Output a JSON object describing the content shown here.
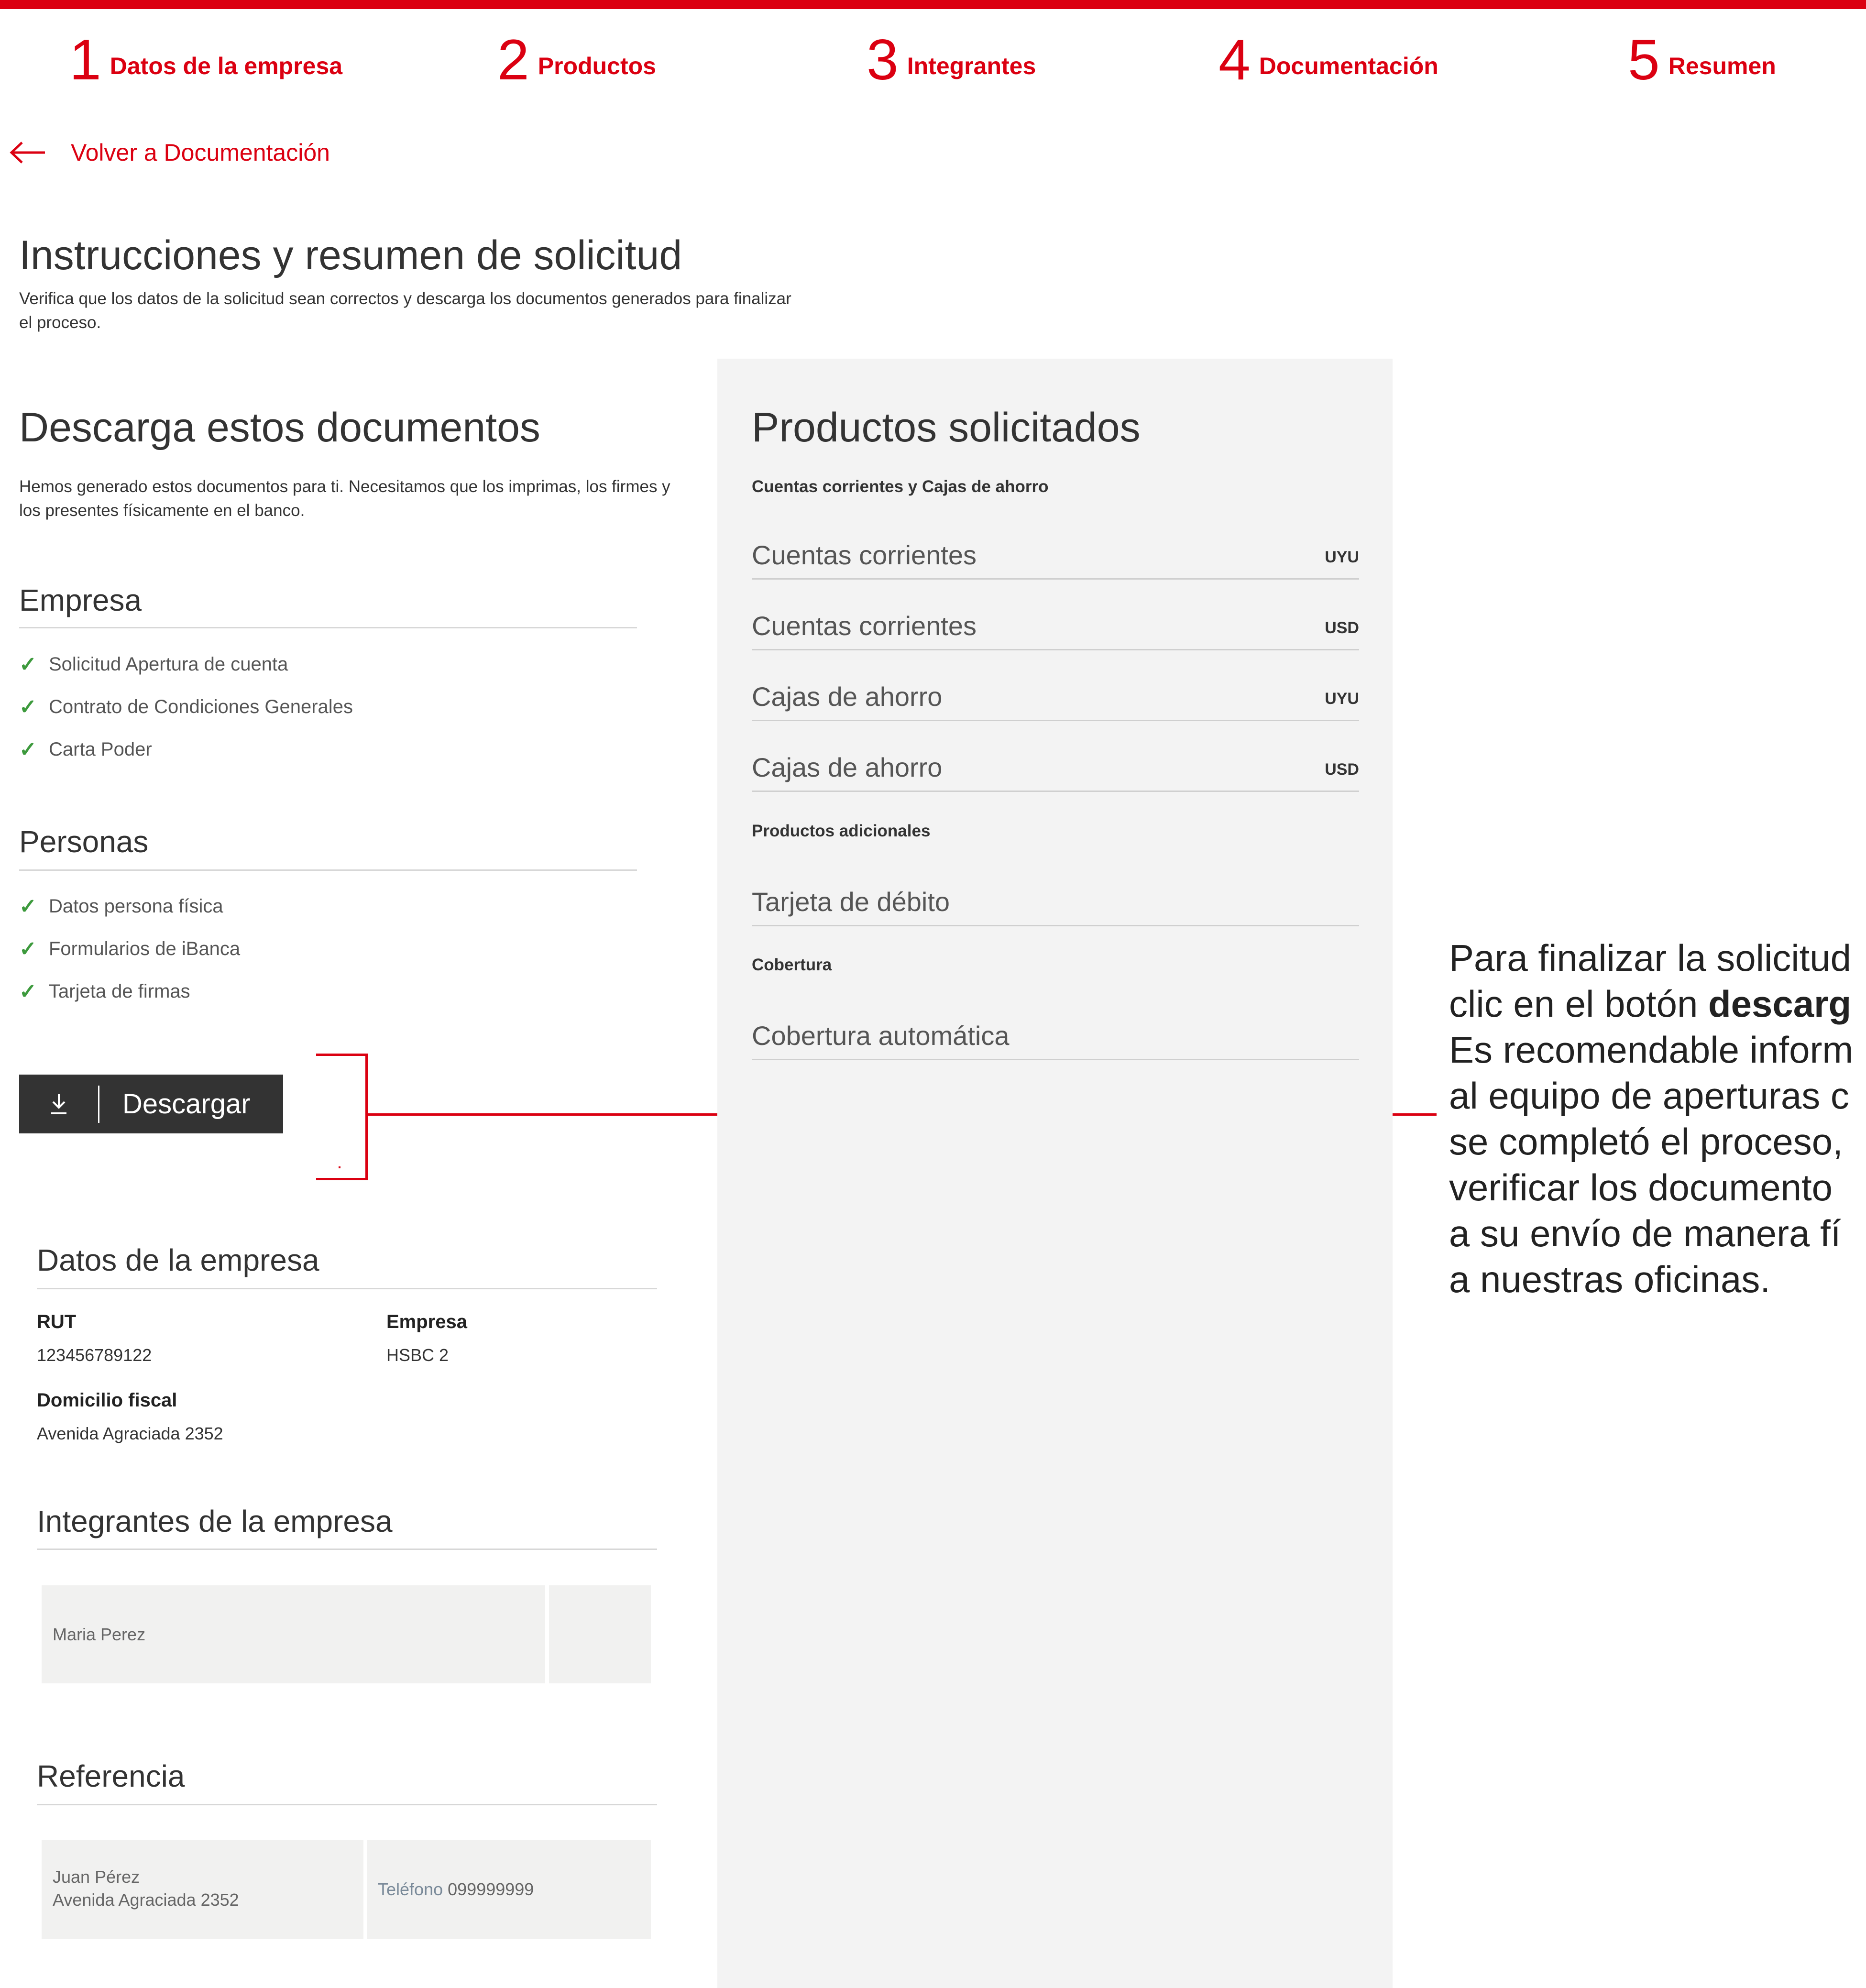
{
  "steps": [
    {
      "num": "1",
      "label": "Datos de la empresa"
    },
    {
      "num": "2",
      "label": "Productos"
    },
    {
      "num": "3",
      "label": "Integrantes"
    },
    {
      "num": "4",
      "label": "Documentación"
    },
    {
      "num": "5",
      "label": "Resumen"
    }
  ],
  "back_link": "Volver a Documentación",
  "page": {
    "title": "Instrucciones y resumen de solicitud",
    "subtitle": "Verifica que los datos de la solicitud sean correctos y descarga los documentos generados para finalizar el proceso."
  },
  "downloads": {
    "title": "Descarga estos documentos",
    "description": "Hemos generado estos documentos para ti. Necesitamos que los imprimas, los firmes y los presentes físicamente en el banco.",
    "empresa": {
      "heading": "Empresa",
      "items": [
        "Solicitud Apertura de cuenta",
        "Contrato de Condiciones Generales",
        "Carta Poder"
      ]
    },
    "personas": {
      "heading": "Personas",
      "items": [
        "Datos persona física",
        "Formularios de iBanca",
        "Tarjeta de firmas"
      ]
    },
    "button_label": "Descargar"
  },
  "company_data": {
    "heading": "Datos de la empresa",
    "rut_label": "RUT",
    "rut_value": "123456789122",
    "empresa_label": "Empresa",
    "empresa_value": "HSBC 2",
    "domicilio_label": "Domicilio fiscal",
    "domicilio_value": "Avenida Agraciada 2352"
  },
  "members": {
    "heading": "Integrantes de la empresa",
    "name": "Maria Perez"
  },
  "reference": {
    "heading": "Referencia",
    "name": "Juan Pérez",
    "address": "Avenida Agraciada 2352",
    "phone_label": "Teléfono",
    "phone_value": "099999999"
  },
  "products": {
    "title": "Productos solicitados",
    "section1": "Cuentas corrientes y Cajas de ahorro",
    "accounts": [
      {
        "name": "Cuentas corrientes",
        "currency": "UYU"
      },
      {
        "name": "Cuentas corrientes",
        "currency": "USD"
      },
      {
        "name": "Cajas de ahorro",
        "currency": "UYU"
      },
      {
        "name": "Cajas de ahorro",
        "currency": "USD"
      }
    ],
    "section2": "Productos adicionales",
    "additional": "Tarjeta de débito",
    "section3": "Cobertura",
    "coverage": "Cobertura automática"
  },
  "callout": {
    "lines": [
      "Para finalizar la solicitud",
      "clic en el botón ",
      "descarg",
      "Es recomendable inform",
      "al equipo de aperturas c",
      "se completó el proceso,",
      "verificar los documento",
      "a su envío de manera fí",
      "a nuestras oficinas."
    ]
  },
  "colors": {
    "accent": "#db0011",
    "check": "#3d9a3d",
    "button": "#333333",
    "panel": "#f3f3f3"
  }
}
